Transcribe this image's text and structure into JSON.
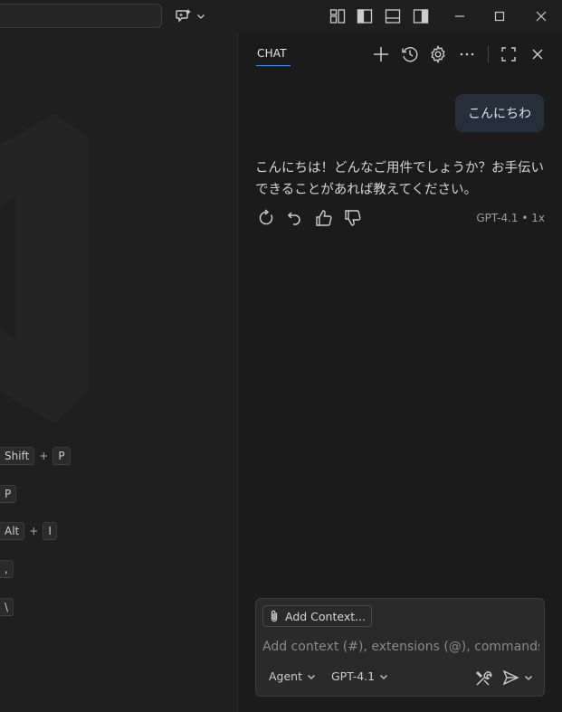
{
  "chat": {
    "tab_label": "CHAT",
    "user_message": "こんにちわ",
    "assistant_message": "こんにちは！どんなご用件でしょうか？お手伝いできることがあれば教えてください。",
    "model_meta": "GPT-4.1 • 1x",
    "add_context_label": "Add Context...",
    "input_placeholder": "Add context (#), extensions (@), commands",
    "mode_label": "Agent",
    "model_label": "GPT-4.1"
  },
  "editor": {
    "shortcuts": [
      {
        "keys": [
          "Shift",
          "P"
        ]
      },
      {
        "keys": [
          "P"
        ]
      },
      {
        "keys": [
          "Alt",
          "I"
        ]
      },
      {
        "keys": [
          ","
        ]
      },
      {
        "keys": [
          "\\"
        ]
      }
    ]
  },
  "colors": {
    "accent": "#3794ff",
    "user_bubble": "#252f39",
    "panel_bg": "#1b1b1b",
    "editor_bg": "#1f1f1f"
  }
}
